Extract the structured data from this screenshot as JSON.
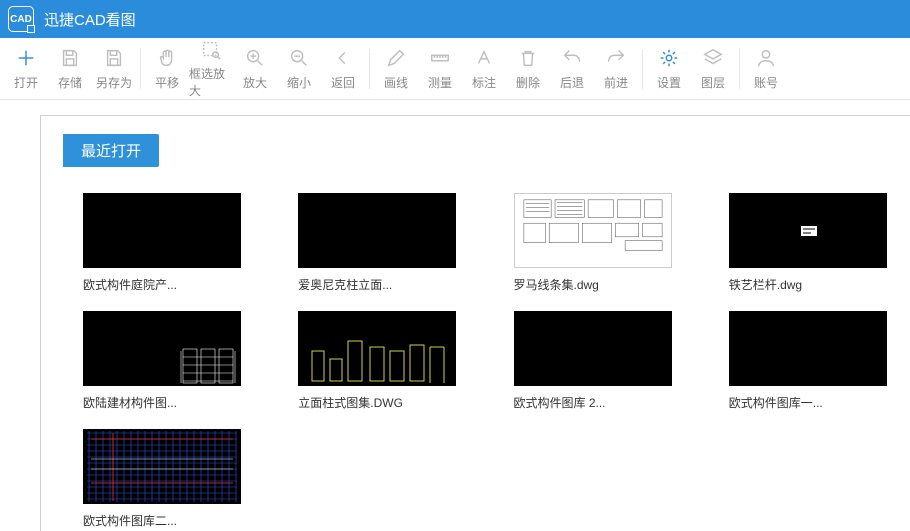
{
  "app": {
    "title": "迅捷CAD看图",
    "icon_label": "CAD"
  },
  "toolbar": {
    "items": [
      {
        "label": "打开",
        "icon": "plus",
        "accent": true
      },
      {
        "label": "存储",
        "icon": "save"
      },
      {
        "label": "另存为",
        "icon": "save"
      },
      {
        "sep": true
      },
      {
        "label": "平移",
        "icon": "hand"
      },
      {
        "label": "框选放大",
        "icon": "box-zoom"
      },
      {
        "label": "放大",
        "icon": "zoom-in"
      },
      {
        "label": "缩小",
        "icon": "zoom-out"
      },
      {
        "label": "返回",
        "icon": "back"
      },
      {
        "sep": true
      },
      {
        "label": "画线",
        "icon": "pencil"
      },
      {
        "label": "测量",
        "icon": "ruler"
      },
      {
        "label": "标注",
        "icon": "text"
      },
      {
        "label": "删除",
        "icon": "trash"
      },
      {
        "label": "后退",
        "icon": "undo"
      },
      {
        "label": "前进",
        "icon": "redo"
      },
      {
        "sep": true
      },
      {
        "label": "设置",
        "icon": "gear",
        "accent": true
      },
      {
        "label": "图层",
        "icon": "layers"
      },
      {
        "sep": true
      },
      {
        "label": "账号",
        "icon": "account"
      }
    ]
  },
  "section": {
    "title": "最近打开"
  },
  "recent": [
    {
      "name": "欧式构件庭院产...",
      "thumb": "blank"
    },
    {
      "name": "爱奥尼克柱立面...",
      "thumb": "blank"
    },
    {
      "name": "罗马线条集.dwg",
      "thumb": "white-blueprint"
    },
    {
      "name": "铁艺栏杆.dwg",
      "thumb": "black-tiny"
    },
    {
      "name": "欧陆建材构件图...",
      "thumb": "black-hatch"
    },
    {
      "name": "立面柱式图集.DWG",
      "thumb": "black-yellow"
    },
    {
      "name": "欧式构件图库 2...",
      "thumb": "blank"
    },
    {
      "name": "欧式构件图库一...",
      "thumb": "blank"
    },
    {
      "name": "欧式构件图库二...",
      "thumb": "black-blue"
    }
  ],
  "colors": {
    "primary": "#2b8cdb",
    "icon": "#bfbfbf",
    "accent_icon": "#2f91da"
  }
}
